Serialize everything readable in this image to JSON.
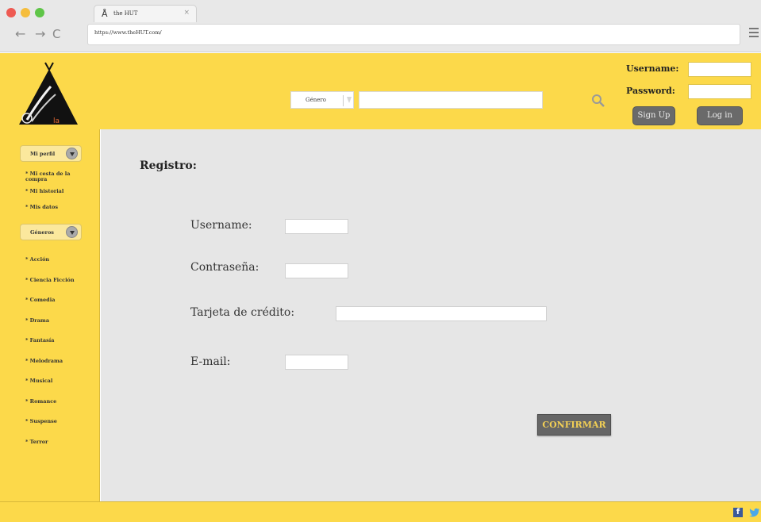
{
  "browser": {
    "tab_title": "the HUT",
    "tab_icon": "teepee-logo",
    "tab_close": "×",
    "url": "https://www.theHUT.com/",
    "back": "←",
    "forward": "→",
    "reload": "C"
  },
  "header": {
    "search": {
      "genre_label": "Género",
      "placeholder": ""
    },
    "login": {
      "username_label": "Username:",
      "password_label": "Password:",
      "signup_label": "Sign Up",
      "login_label": "Log in"
    }
  },
  "sidebar": {
    "profile_label": "Mi perfil",
    "profile_items": [
      "* Mi cesta de la compra",
      "* Mi historial",
      "* Mis datos"
    ],
    "genres_label": "Géneros",
    "genre_items": [
      "* Acción",
      "* Ciencia Ficción",
      "* Comedia",
      "* Drama",
      "* Fantasía",
      "* Melodrama",
      "* Musical",
      "* Romance",
      "* Suspense",
      "* Terror"
    ]
  },
  "main": {
    "title": "Registro:",
    "fields": [
      {
        "label": "Username:",
        "value": ""
      },
      {
        "label": "Contraseña:",
        "value": ""
      },
      {
        "label": "Tarjeta de crédito:",
        "value": ""
      },
      {
        "label": "E-mail:",
        "value": ""
      }
    ],
    "confirm_label": "CONFIRMAR"
  },
  "footer": {
    "facebook": "f"
  },
  "colors": {
    "brand_yellow": "#fcd94a",
    "content_bg": "#e6e6e6",
    "button_gray": "#666666",
    "confirm_text": "#f2cf55"
  }
}
